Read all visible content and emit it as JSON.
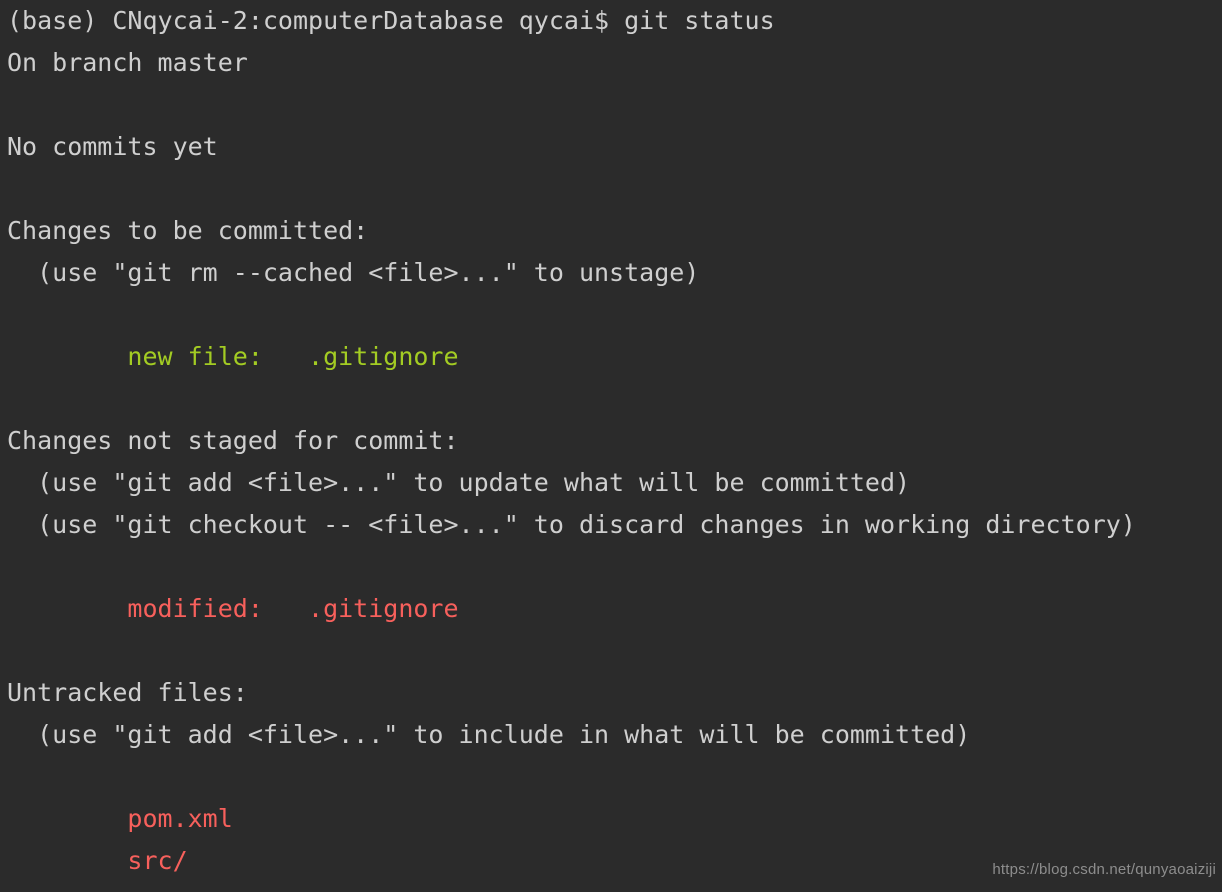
{
  "terminal": {
    "background_color": "#2b2b2b",
    "default_text_color": "#cfcfcf",
    "green_color": "#a3cc23",
    "red_color": "#f7605c",
    "lines": [
      {
        "text": "(base) CNqycai-2:computerDatabase qycai$ git status",
        "color": "default"
      },
      {
        "text": "On branch master",
        "color": "default"
      },
      {
        "text": "",
        "color": "default"
      },
      {
        "text": "No commits yet",
        "color": "default"
      },
      {
        "text": "",
        "color": "default"
      },
      {
        "text": "Changes to be committed:",
        "color": "default"
      },
      {
        "text": "  (use \"git rm --cached <file>...\" to unstage)",
        "color": "default"
      },
      {
        "text": "",
        "color": "default"
      },
      {
        "text": "        new file:   .gitignore",
        "color": "green"
      },
      {
        "text": "",
        "color": "default"
      },
      {
        "text": "Changes not staged for commit:",
        "color": "default"
      },
      {
        "text": "  (use \"git add <file>...\" to update what will be committed)",
        "color": "default"
      },
      {
        "text": "  (use \"git checkout -- <file>...\" to discard changes in working directory)",
        "color": "default"
      },
      {
        "text": "",
        "color": "default"
      },
      {
        "text": "        modified:   .gitignore",
        "color": "red"
      },
      {
        "text": "",
        "color": "default"
      },
      {
        "text": "Untracked files:",
        "color": "default"
      },
      {
        "text": "  (use \"git add <file>...\" to include in what will be committed)",
        "color": "default"
      },
      {
        "text": "",
        "color": "default"
      },
      {
        "text": "        pom.xml",
        "color": "red"
      },
      {
        "text": "        src/",
        "color": "red"
      }
    ]
  },
  "watermark": {
    "text": "https://blog.csdn.net/qunyaoaiziji"
  }
}
